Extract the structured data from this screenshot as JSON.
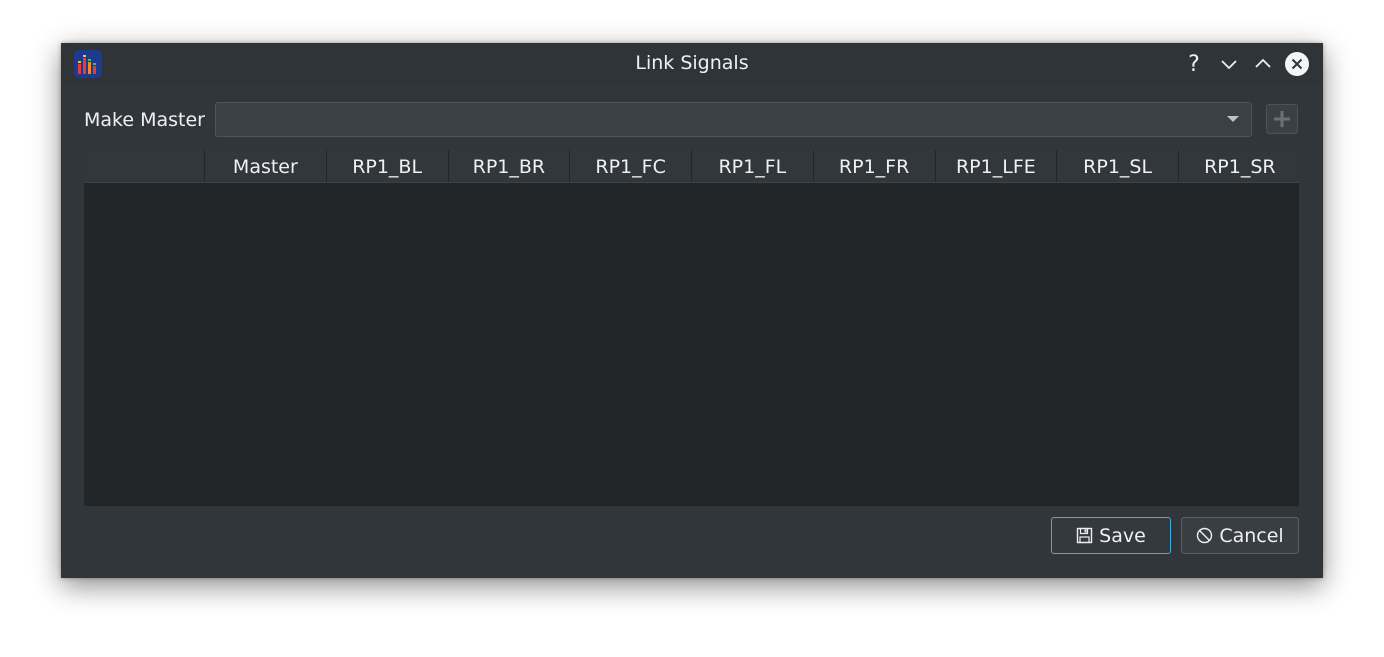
{
  "window": {
    "title": "Link Signals",
    "help_glyph": "?"
  },
  "form": {
    "make_master_label": "Make Master",
    "master_combo_value": ""
  },
  "table": {
    "columns": [
      "",
      "Master",
      "RP1_BL",
      "RP1_BR",
      "RP1_FC",
      "RP1_FL",
      "RP1_FR",
      "RP1_LFE",
      "RP1_SL",
      "RP1_SR"
    ],
    "rows": []
  },
  "buttons": {
    "save_label": "Save",
    "cancel_label": "Cancel"
  },
  "icons": {
    "app": "equalizer-app-icon",
    "help": "help-icon",
    "minimize": "chevron-down-icon",
    "maximize": "chevron-up-icon",
    "close": "close-icon",
    "combo_arrow": "dropdown-arrow-icon",
    "add": "plus-icon",
    "save": "save-icon",
    "cancel": "cancel-icon"
  },
  "colors": {
    "window_bg": "#31363b",
    "table_bg": "#232629",
    "accent": "#3daee9",
    "text": "#eff0f1"
  }
}
